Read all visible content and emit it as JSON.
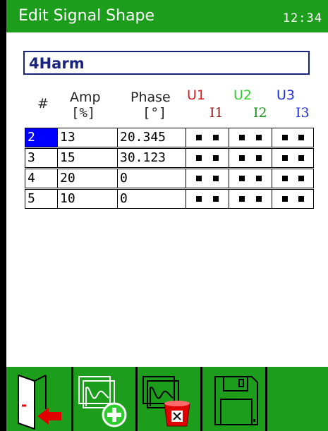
{
  "title": "Edit Signal Shape",
  "clock": "12:34",
  "signal_name": "4Harm",
  "headers": {
    "num": "#",
    "amp": "Amp",
    "amp_unit": "[%]",
    "phase": "Phase",
    "phase_unit": "[°]"
  },
  "channels": {
    "u1": "U1",
    "i1": "I1",
    "u2": "U2",
    "i2": "I2",
    "u3": "U3",
    "i3": "I3"
  },
  "colors": {
    "title_bar": "#1c9e1c",
    "u1": "#d61f1f",
    "i1": "#8b1a1a",
    "u2": "#2ecc2e",
    "i2": "#1b8f1b",
    "u3": "#1f2fd6",
    "i3": "#1f2fd6",
    "selected_cell": "#0000ff",
    "name_text": "#1a237e"
  },
  "rows": [
    {
      "num": "2",
      "amp": "13",
      "phase": "20.345"
    },
    {
      "num": "3",
      "amp": "15",
      "phase": "30.123"
    },
    {
      "num": "4",
      "amp": "20",
      "phase": "0"
    },
    {
      "num": "5",
      "amp": "10",
      "phase": "0"
    }
  ],
  "selected_row": 0,
  "toolbar": {
    "buttons": [
      {
        "name": "exit-button",
        "icon": "exit-door-icon"
      },
      {
        "name": "add-harmonic-button",
        "icon": "add-signal-icon"
      },
      {
        "name": "delete-harmonic-button",
        "icon": "delete-signal-icon"
      },
      {
        "name": "save-button",
        "icon": "floppy-disk-icon"
      },
      {
        "name": "empty-softkey",
        "icon": ""
      }
    ]
  }
}
